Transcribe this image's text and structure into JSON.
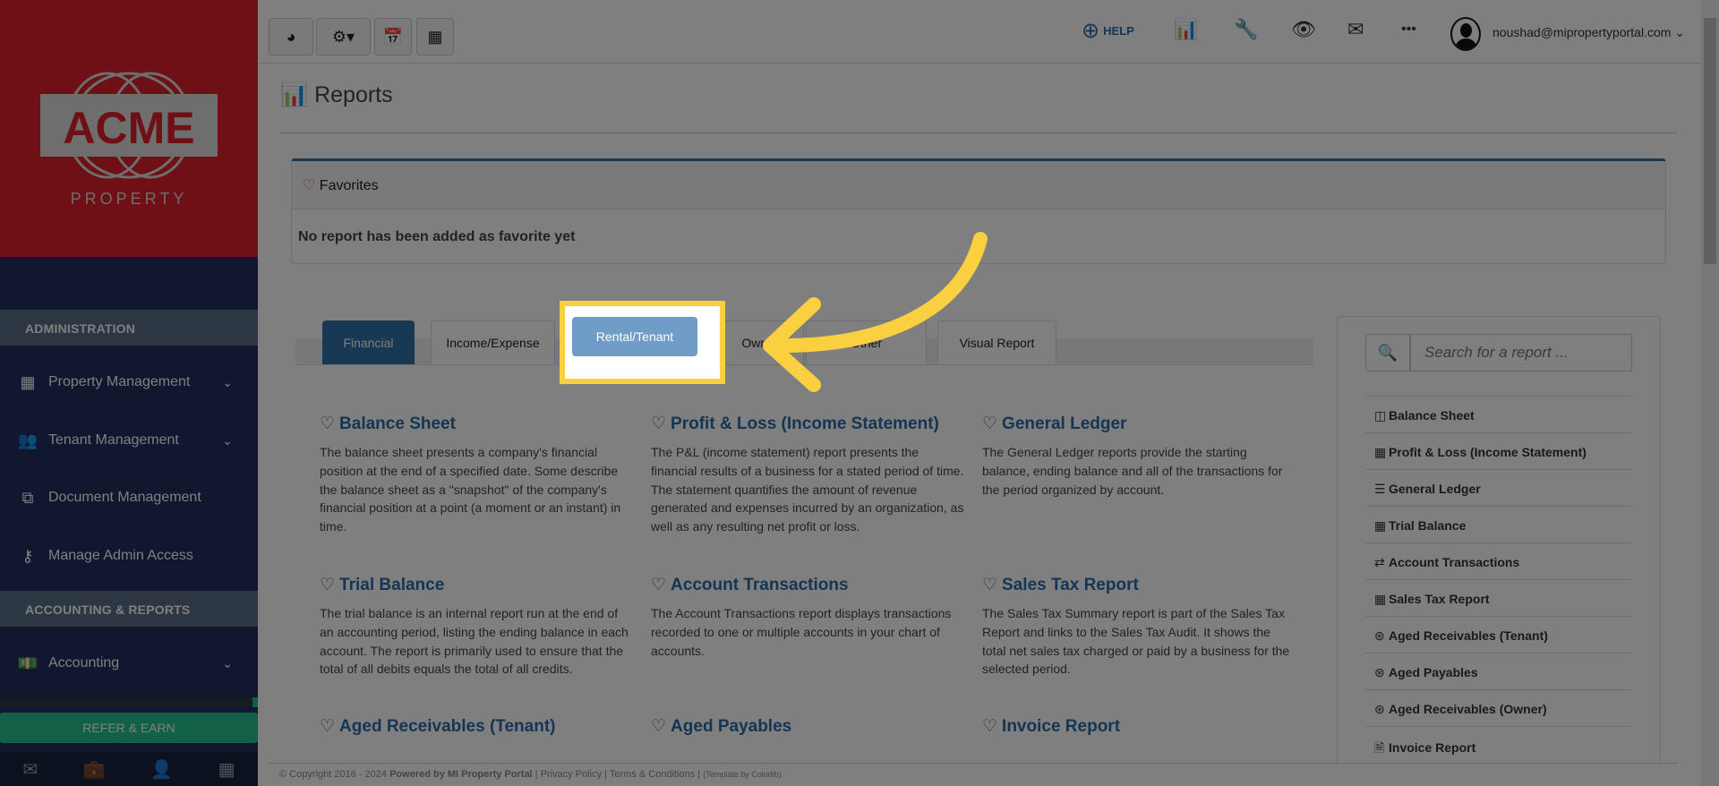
{
  "logo": {
    "text": "ACME",
    "sub": "PROPERTY"
  },
  "sidebar": {
    "sections": [
      "ADMINISTRATION",
      "ACCOUNTING & REPORTS"
    ],
    "items": [
      {
        "label": "Property Management"
      },
      {
        "label": "Tenant Management"
      },
      {
        "label": "Document Management"
      },
      {
        "label": "Manage Admin Access"
      },
      {
        "label": "Accounting"
      }
    ],
    "refer": "REFER & EARN"
  },
  "topbar": {
    "help": "HELP",
    "user": "noushad@mipropertyportal.com"
  },
  "page": {
    "title": "Reports"
  },
  "favorites": {
    "title": "Favorites",
    "empty": "No report has been added as favorite yet"
  },
  "tabs": [
    "Financial",
    "Income/Expense",
    "Rental/Tenant",
    "Owner",
    "Other",
    "Visual Report"
  ],
  "reports": [
    {
      "title": "Balance Sheet",
      "desc": "The balance sheet presents a company's financial position at the end of a specified date. Some describe the balance sheet as a \"snapshot\" of the company's financial position at a point (a moment or an instant) in time."
    },
    {
      "title": "Profit & Loss (Income Statement)",
      "desc": "The P&L (income statement) report presents the financial results of a business for a stated period of time. The statement quantifies the amount of revenue generated and expenses incurred by an organization, as well as any resulting net profit or loss."
    },
    {
      "title": "General Ledger",
      "desc": "The General Ledger reports provide the starting balance, ending balance and all of the transactions for the period organized by account."
    },
    {
      "title": "Trial Balance",
      "desc": "The trial balance is an internal report run at the end of an accounting period, listing the ending balance in each account. The report is primarily used to ensure that the total of all debits equals the total of all credits."
    },
    {
      "title": "Account Transactions",
      "desc": "The Account Transactions report displays transactions recorded to one or multiple accounts in your chart of accounts."
    },
    {
      "title": "Sales Tax Report",
      "desc": "The Sales Tax Summary report is part of the Sales Tax Report and links to the Sales Tax Audit. It shows the total net sales tax charged or paid by a business for the selected period."
    },
    {
      "title": "Aged Receivables (Tenant)"
    },
    {
      "title": "Aged Payables"
    },
    {
      "title": "Invoice Report"
    }
  ],
  "search": {
    "placeholder": "Search for a report ..."
  },
  "report_list": [
    "Balance Sheet",
    "Profit & Loss (Income Statement)",
    "General Ledger",
    "Trial Balance",
    "Account Transactions",
    "Sales Tax Report",
    "Aged Receivables (Tenant)",
    "Aged Payables",
    "Aged Receivables (Owner)",
    "Invoice Report"
  ],
  "footer": {
    "copyright": "© Copyright 2016 - 2024",
    "powered": "Powered by MI Property Portal",
    "privacy": "Privacy Policy",
    "terms": "Terms & Conditions",
    "template": "(Template by Colorlib)"
  },
  "colors": {
    "highlight": "#fad040",
    "brand_red": "#dc202c",
    "navy": "#202f5e",
    "active_tab": "#3070a6"
  }
}
